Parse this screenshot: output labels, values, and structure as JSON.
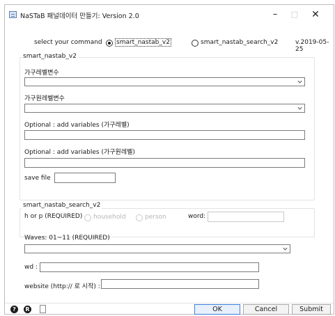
{
  "window": {
    "title": "NaSTaB 패널데이터 만들기: Version 2.0",
    "minimize": "–",
    "maximize": "□",
    "close": "✕"
  },
  "command": {
    "label": "select your command",
    "options": [
      "smart_nastab_v2",
      "smart_nastab_search_v2"
    ],
    "selected": "smart_nastab_v2",
    "version": "v.2019-05-25"
  },
  "group1": {
    "title": "smart_nastab_v2",
    "household_var_label": "가구레벨변수",
    "household_member_var_label": "가구원레벨변수",
    "optional_household_label": "Optional : add variables (가구레벨)",
    "optional_member_label": "Optional : add variables (가구원레벨)",
    "save_file_label": "save file",
    "household_var_value": "",
    "household_member_var_value": "",
    "optional_household_value": "",
    "optional_member_value": "",
    "save_file_value": ""
  },
  "group2": {
    "title": "smart_nastab_search_v2",
    "hp_label": "h or p (REQUIRED)",
    "hp_options": [
      "household",
      "person"
    ],
    "word_label": "word:",
    "word_value": ""
  },
  "group3": {
    "waves_label": "Waves: 01~11 (REQUIRED)",
    "waves_value": "",
    "wd_label": "wd :",
    "wd_value": "",
    "website_label": "website (http:// 로 시작) :",
    "website_value": ""
  },
  "footer": {
    "help_icon": "?",
    "r_icon": "R",
    "ok_label": "OK",
    "cancel_label": "Cancel",
    "submit_label": "Submit"
  }
}
